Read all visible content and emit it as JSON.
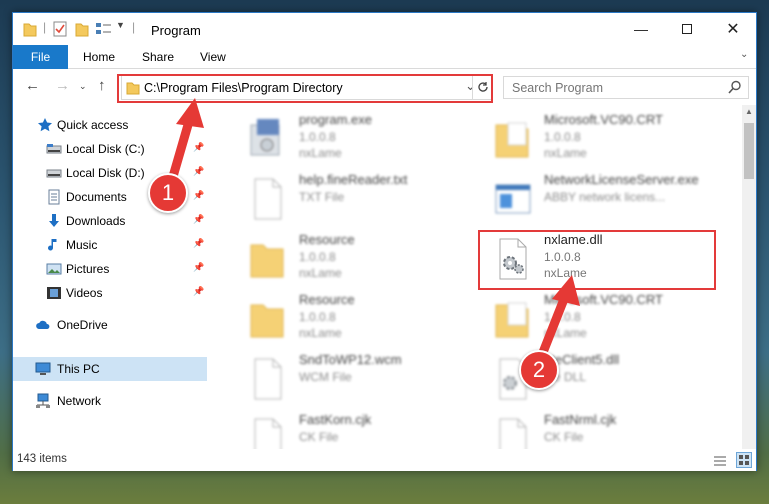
{
  "window": {
    "title": "Program"
  },
  "ribbon": {
    "tabs": [
      "File",
      "Home",
      "Share",
      "View"
    ]
  },
  "address": {
    "path": "C:\\Program Files\\Program Directory"
  },
  "search": {
    "placeholder": "Search Program"
  },
  "sidebar": {
    "items": [
      {
        "label": "Quick access",
        "icon": "star-icon"
      },
      {
        "label": "Local Disk (C:)",
        "icon": "drive-icon",
        "pinned": true
      },
      {
        "label": "Local Disk (D:)",
        "icon": "drive-icon",
        "pinned": true
      },
      {
        "label": "Documents",
        "icon": "documents-icon",
        "pinned": true
      },
      {
        "label": "Downloads",
        "icon": "downloads-icon",
        "pinned": true
      },
      {
        "label": "Music",
        "icon": "music-icon",
        "pinned": true
      },
      {
        "label": "Pictures",
        "icon": "pictures-icon",
        "pinned": true
      },
      {
        "label": "Videos",
        "icon": "videos-icon",
        "pinned": true
      },
      {
        "label": "OneDrive",
        "icon": "cloud-icon"
      },
      {
        "label": "This PC",
        "icon": "computer-icon",
        "selected": true
      },
      {
        "label": "Network",
        "icon": "network-icon"
      }
    ]
  },
  "files": [
    {
      "name": "program.exe",
      "line2": "1.0.0.8",
      "line3": "nxLame",
      "icon": "installer-icon"
    },
    {
      "name": "Microsoft.VC90.CRT",
      "line2": "1.0.0.8",
      "line3": "nxLame",
      "icon": "folder-icon"
    },
    {
      "name": "help.fineReader.txt",
      "line2": "TXT File",
      "line3": "",
      "icon": "blank-file-icon"
    },
    {
      "name": "NetworkLicenseServer.exe",
      "line2": "ABBY network licens...",
      "line3": "",
      "icon": "window-app-icon"
    },
    {
      "name": "Resource",
      "line2": "1.0.0.8",
      "line3": "nxLame",
      "icon": "folder-icon"
    },
    {
      "name": "nxlame.dll",
      "line2": "1.0.0.8",
      "line3": "nxLame",
      "icon": "dll-gear-icon"
    },
    {
      "name": "Resource",
      "line2": "1.0.0.8",
      "line3": "nxLame",
      "icon": "folder-icon"
    },
    {
      "name": "Microsoft.VC90.CRT",
      "line2": "1.0.0.8",
      "line3": "nxLame",
      "icon": "folder-icon"
    },
    {
      "name": "SndToWP12.wcm",
      "line2": "WCM File",
      "line3": "",
      "icon": "blank-file-icon"
    },
    {
      "name": "ateClient5.dll",
      "line2": "rce DLL",
      "line3": "",
      "icon": "dll-gear-icon"
    },
    {
      "name": "FastKorn.cjk",
      "line2": "CK File",
      "line3": "",
      "icon": "blank-file-icon"
    },
    {
      "name": "FastNrml.cjk",
      "line2": "CK File",
      "line3": "",
      "icon": "blank-file-icon"
    }
  ],
  "status": {
    "count": "143 items"
  },
  "annotations": {
    "step1": "1",
    "step2": "2"
  },
  "colors": {
    "accent": "#1979ca",
    "annotation": "#e53935",
    "selection": "#cde3f5"
  }
}
